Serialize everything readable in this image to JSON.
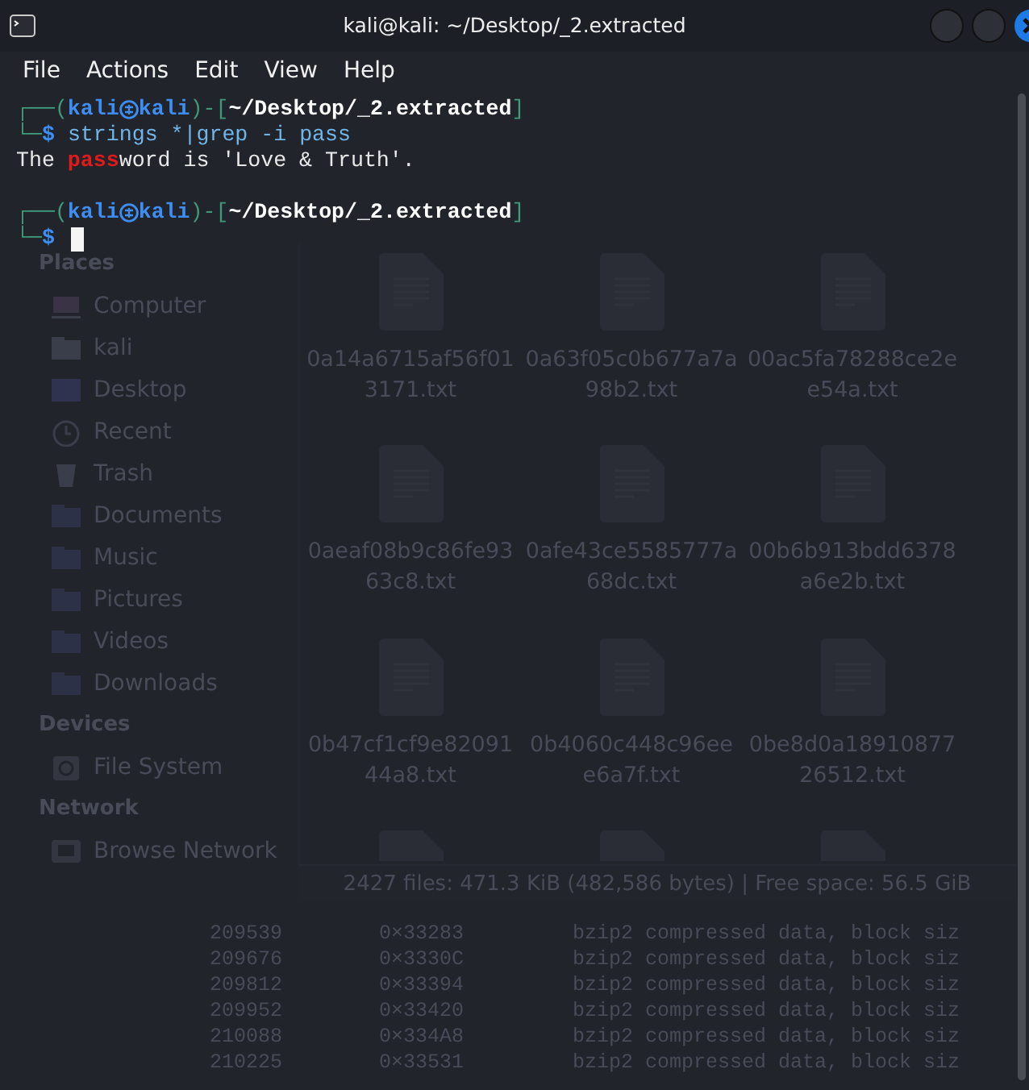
{
  "window": {
    "title": "kali@kali: ~/Desktop/_2.extracted"
  },
  "menu": [
    "File",
    "Actions",
    "Edit",
    "View",
    "Help"
  ],
  "terminal": {
    "lines": [
      {
        "kind": "prompt",
        "frame_open": "┌──(",
        "user": "kali",
        "host": "kali",
        "frame_mid": ")-[",
        "path": "~/Desktop/_2.extracted",
        "frame_close": "]",
        "frame_bottom": "└─",
        "sigil": "$",
        "command": "strings *|grep -i pass",
        "cursor": false
      },
      {
        "kind": "output",
        "before": "The ",
        "match": "pass",
        "after": "word is 'Love & Truth'."
      },
      {
        "kind": "blank"
      },
      {
        "kind": "prompt",
        "frame_open": "┌──(",
        "user": "kali",
        "host": "kali",
        "frame_mid": ")-[",
        "path": "~/Desktop/_2.extracted",
        "frame_close": "]",
        "frame_bottom": "└─",
        "sigil": "$",
        "cursor": true
      }
    ]
  },
  "background_file_manager": {
    "sidebar": [
      {
        "heading": "Places",
        "items": [
          {
            "kind": "computer",
            "label": "Computer"
          },
          {
            "kind": "home",
            "label": "kali"
          },
          {
            "kind": "desktop",
            "label": "Desktop"
          },
          {
            "kind": "recent",
            "label": "Recent"
          },
          {
            "kind": "trash",
            "label": "Trash"
          },
          {
            "kind": "folder",
            "label": "Documents"
          },
          {
            "kind": "folder",
            "label": "Music"
          },
          {
            "kind": "folder",
            "label": "Pictures"
          },
          {
            "kind": "folder",
            "label": "Videos"
          },
          {
            "kind": "folder",
            "label": "Downloads"
          }
        ]
      },
      {
        "heading": "Devices",
        "items": [
          {
            "kind": "drive",
            "label": "File System"
          }
        ]
      },
      {
        "heading": "Network",
        "items": [
          {
            "kind": "network",
            "label": "Browse Network"
          }
        ]
      }
    ],
    "files": [
      "0a14a6715af56f013171.txt",
      "0a63f05c0b677a7a98b2.txt",
      "00ac5fa78288ce2ee54a.txt",
      "0aeaf08b9c86fe9363c8.txt",
      "0afe43ce5585777a68dc.txt",
      "00b6b913bdd6378a6e2b.txt",
      "0b47cf1cf9e8209144a8.txt",
      "0b4060c448c96eee6a7f.txt",
      "0be8d0a1891087726512.txt"
    ],
    "status_bar": "2427 files: 471.3 KiB (482,586 bytes) | Free space: 56.5 GiB"
  },
  "background_terminal": {
    "rows": [
      [
        "209539",
        "0×33283",
        "bzip2 compressed data, block siz"
      ],
      [
        "209676",
        "0×3330C",
        "bzip2 compressed data, block siz"
      ],
      [
        "209812",
        "0×33394",
        "bzip2 compressed data, block siz"
      ],
      [
        "209952",
        "0×33420",
        "bzip2 compressed data, block siz"
      ],
      [
        "210088",
        "0×334A8",
        "bzip2 compressed data, block siz"
      ],
      [
        "210225",
        "0×33531",
        "bzip2 compressed data, block siz"
      ]
    ]
  }
}
